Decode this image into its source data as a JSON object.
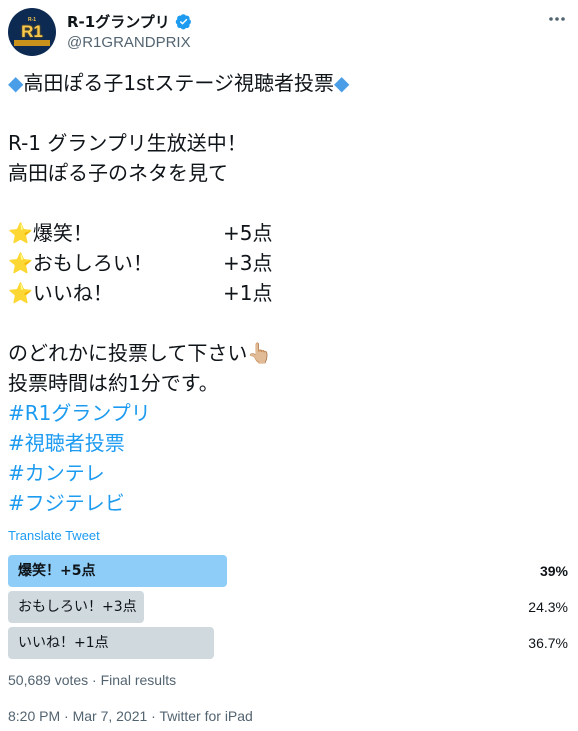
{
  "author": {
    "display_name": "R-1グランプリ",
    "handle": "@R1GRANDPRIX",
    "verified": true,
    "avatar": {
      "top_text": "R-1",
      "main_text": "R1"
    }
  },
  "tweet": {
    "title": {
      "diamond_left": "◆",
      "text": "高田ぽる子1stステージ視聴者投票",
      "diamond_right": "◆"
    },
    "intro_lines": [
      "R-1 グランプリ生放送中！",
      "高田ぽる子のネタを見て"
    ],
    "scores": [
      {
        "star": "⭐",
        "label": "爆笑！",
        "points": "+5点"
      },
      {
        "star": "⭐",
        "label": "おもしろい！",
        "points": "+3点"
      },
      {
        "star": "⭐",
        "label": "いいね！",
        "points": "+1点"
      }
    ],
    "closing_lines": [
      "のどれかに投票して下さい👆🏼",
      "投票時間は約1分です。"
    ],
    "hashtags": [
      "#R1グランプリ",
      "#視聴者投票",
      "#カンテレ",
      "#フジテレビ"
    ]
  },
  "translate_label": "Translate Tweet",
  "poll": {
    "options": [
      {
        "label": "爆笑！+5点",
        "percent_text": "39%",
        "percent": 39,
        "winner": true
      },
      {
        "label": "おもしろい！+3点",
        "percent_text": "24.3%",
        "percent": 24.3,
        "winner": false
      },
      {
        "label": "いいね！+1点",
        "percent_text": "36.7%",
        "percent": 36.7,
        "winner": false
      }
    ],
    "summary": "50,689 votes · Final results"
  },
  "meta": "8:20 PM · Mar 7, 2021 · Twitter for iPad",
  "icons": {
    "verified": "verified-badge-icon",
    "more": "more-dots-icon"
  },
  "colors": {
    "accent": "#1d9bf0",
    "poll_winner": "#8ecdf7",
    "poll_other": "#cfd9de",
    "muted": "#536471"
  }
}
